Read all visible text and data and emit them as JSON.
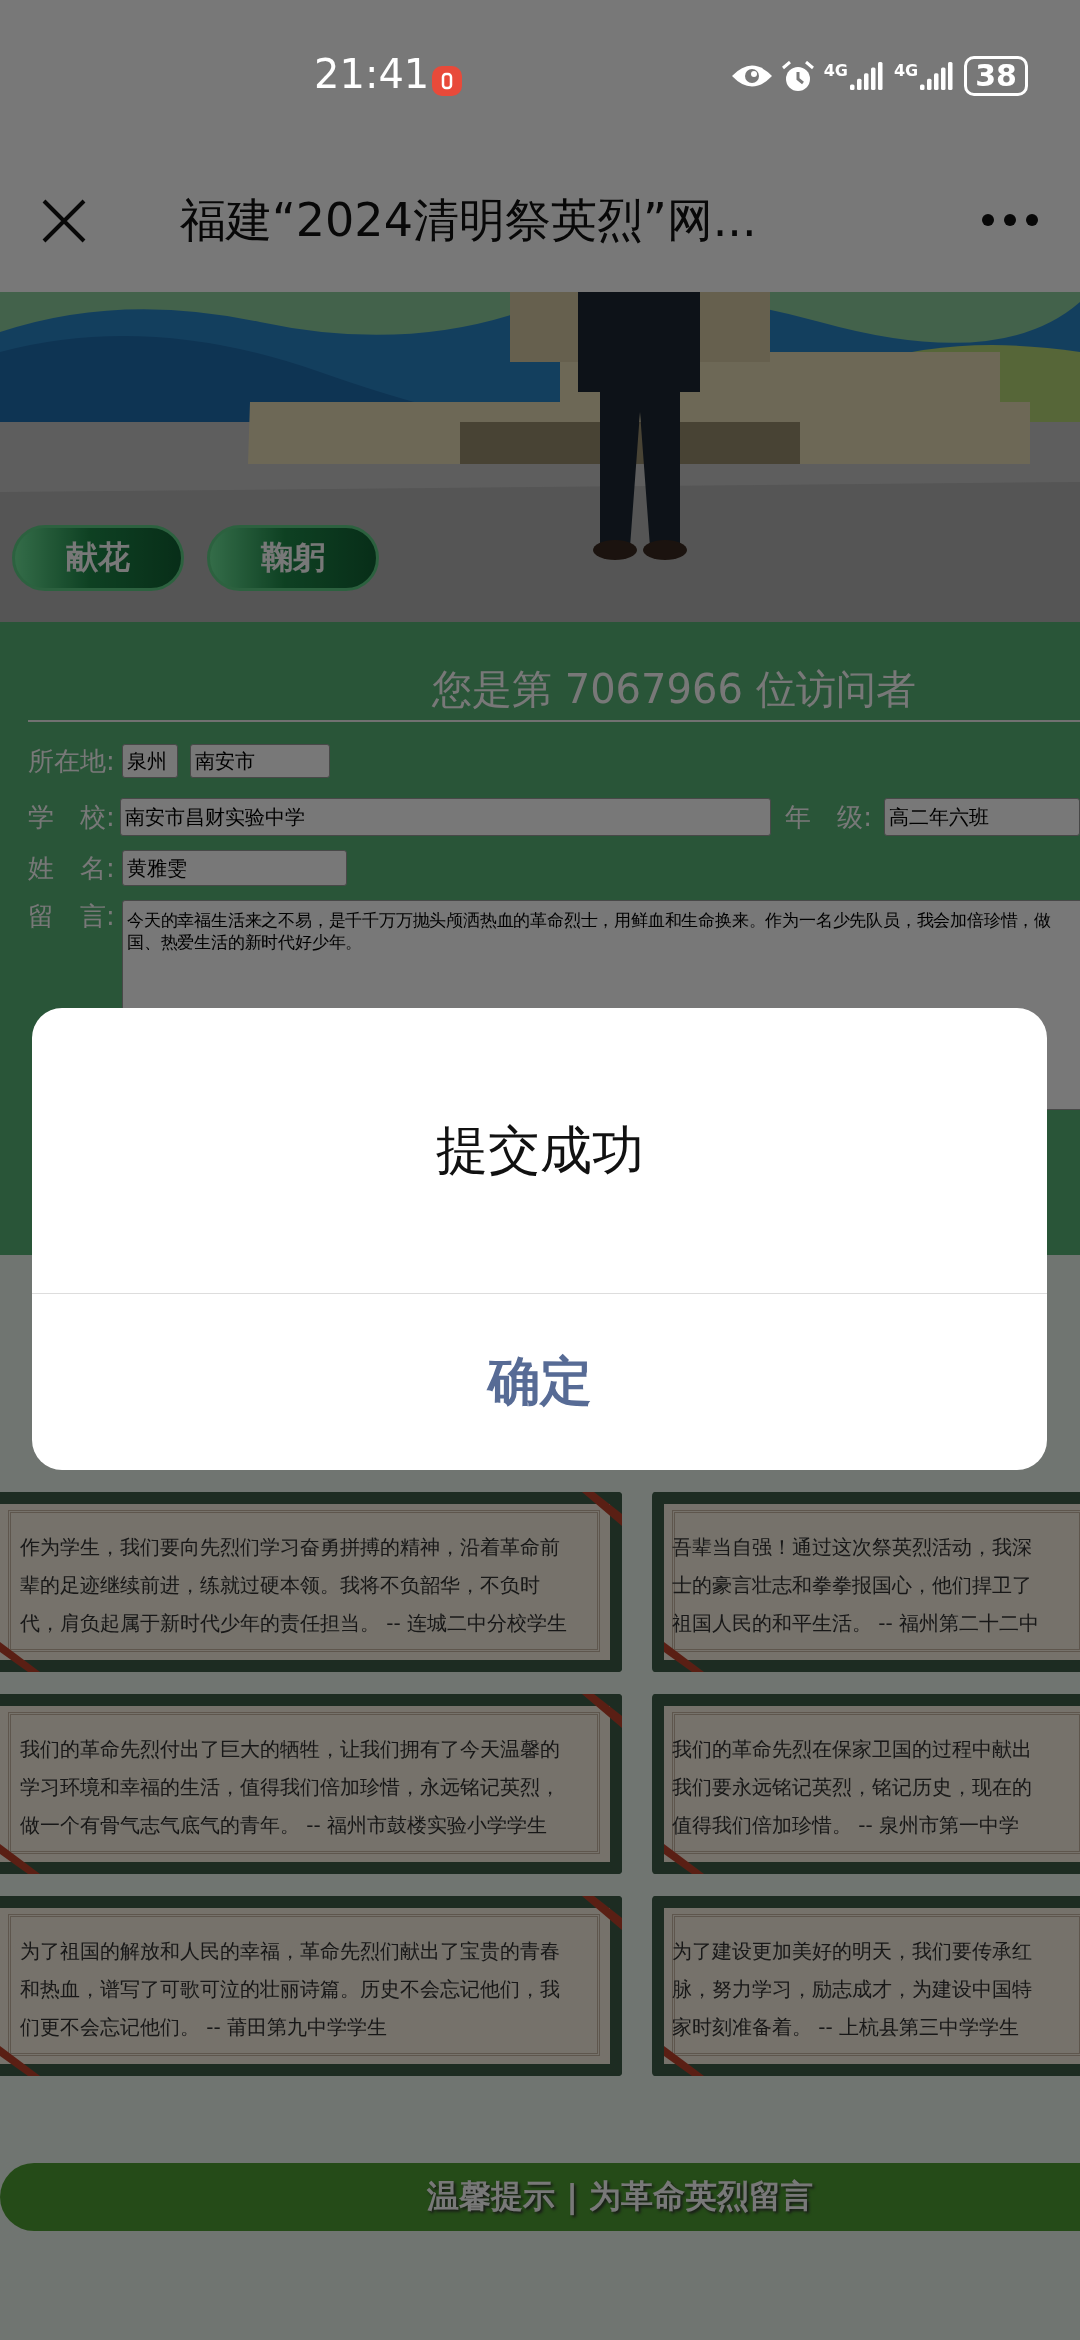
{
  "status_bar": {
    "time": "21:41",
    "network_1": "4G",
    "network_2": "4G",
    "battery": "38"
  },
  "title_bar": {
    "title": "福建“2024清明祭英烈”网..."
  },
  "scene": {
    "kind": "picture",
    "actions": [
      {
        "label": "献花"
      },
      {
        "label": "鞠躬"
      }
    ]
  },
  "visitor_counter": "您是第 7067966 位访问者",
  "form": {
    "location_label": "所在地:",
    "province": "泉州",
    "city": "南安市",
    "school_label": "学　校:",
    "school": "南安市昌财实验中学",
    "grade_label": "年　级:",
    "grade": "高二年六班",
    "name_label": "姓　名:",
    "name": "黄雅雯",
    "message_label": "留　言:",
    "message_lines": [
      "今天的幸福生活来之不易，是千千万万抛头颅洒热血的革命烈士，用鲜血和生命换来。作为一名少先队员，我会加倍珍惜，做",
      "国、热爱生活的新时代好少年。"
    ]
  },
  "messages": [
    {
      "lines": [
        "作为学生，我们要向先烈们学习奋勇拼搏的精神，沿着革命前",
        "辈的足迹继续前进，练就过硬本领。我将不负韶华，不负时",
        "代，肩负起属于新时代少年的责任担当。 -- 连城二中分校学生"
      ]
    },
    {
      "lines": [
        "吾辈当自强！通过这次祭英烈活动，我深",
        "士的豪言壮志和拳拳报国心，他们捍卫了",
        "祖国人民的和平生活。 -- 福州第二十二中"
      ]
    },
    {
      "lines": [
        "我们的革命先烈付出了巨大的牺牲，让我们拥有了今天温馨的",
        "学习环境和幸福的生活，值得我们倍加珍惜，永远铭记英烈，",
        "做一个有骨气志气底气的青年。 -- 福州市鼓楼实验小学学生"
      ]
    },
    {
      "lines": [
        "我们的革命先烈在保家卫国的过程中献出",
        "我们要永远铭记英烈，铭记历史，现在的",
        "值得我们倍加珍惜。 -- 泉州市第一中学"
      ]
    },
    {
      "lines": [
        "为了祖国的解放和人民的幸福，革命先烈们献出了宝贵的青春",
        "和热血，谱写了可歌可泣的壮丽诗篇。历史不会忘记他们，我",
        "们更不会忘记他们。 -- 莆田第九中学学生"
      ]
    },
    {
      "lines": [
        "为了建设更加美好的明天，我们要传承红",
        "脉，努力学习，励志成才，为建设中国特",
        "家时刻准备着。 -- 上杭县第三中学学生"
      ]
    }
  ],
  "tip_banner": "温馨提示 | 为革命英烈留言",
  "dialog": {
    "title": "提交成功",
    "button": "确定"
  }
}
